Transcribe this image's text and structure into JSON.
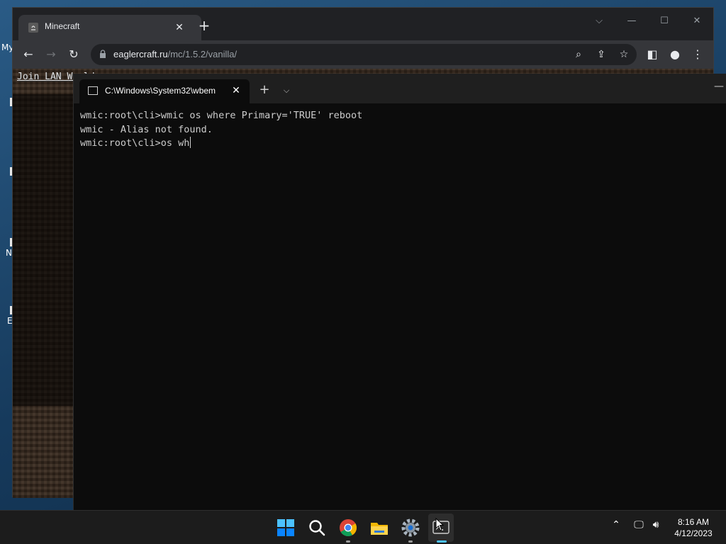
{
  "desktop": {
    "icons": [
      {
        "label": "My"
      },
      {
        "label": ""
      },
      {
        "label": ""
      },
      {
        "label": "N"
      },
      {
        "label": "E"
      }
    ]
  },
  "browser": {
    "tab_title": "Minecraft",
    "url_host": "eaglercraft.ru",
    "url_path": "/mc/1.5.2/vanilla/",
    "page_text": "Join LAN World"
  },
  "terminal": {
    "tab_title": "C:\\Windows\\System32\\wbem",
    "lines": [
      "wmic:root\\cli>wmic os where Primary='TRUE' reboot",
      "wmic - Alias not found.",
      "wmic:root\\cli>os wh"
    ]
  },
  "taskbar": {
    "time": "8:16 AM",
    "date": "4/12/2023"
  },
  "colors": {
    "terminal_bg": "#0c0c0c",
    "terminal_fg": "#cccccc",
    "chrome_dark": "#202124",
    "chrome_toolbar": "#35363a",
    "accent_windows": "#0a84ff"
  }
}
